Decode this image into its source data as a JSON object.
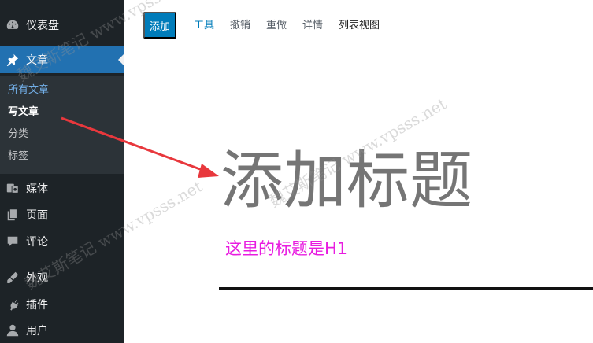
{
  "sidebar": {
    "items": [
      {
        "label": "仪表盘",
        "icon": "dashboard-icon"
      },
      {
        "label": "文章",
        "icon": "pin-icon"
      },
      {
        "label": "媒体",
        "icon": "media-icon"
      },
      {
        "label": "页面",
        "icon": "page-icon"
      },
      {
        "label": "评论",
        "icon": "comment-icon"
      },
      {
        "label": "外观",
        "icon": "appearance-icon"
      },
      {
        "label": "插件",
        "icon": "plugin-icon"
      },
      {
        "label": "用户",
        "icon": "user-icon"
      }
    ],
    "submenu": [
      {
        "label": "所有文章"
      },
      {
        "label": "写文章"
      },
      {
        "label": "分类"
      },
      {
        "label": "标签"
      }
    ]
  },
  "toolbar": {
    "add_label": "添加",
    "tools_label": "工具",
    "undo_label": "撤销",
    "redo_label": "重做",
    "details_label": "详情",
    "list_view_label": "列表视图"
  },
  "editor": {
    "title_placeholder": "添加标题",
    "annotation": "这里的标题是H1"
  },
  "watermark": {
    "text": "魏艾斯笔记 www.vpsss.net"
  },
  "colors": {
    "sidebar_bg": "#1d2327",
    "active_bg": "#2271b1",
    "primary_button": "#007cba",
    "annotation": "#e81ce0",
    "arrow": "#e8383d"
  }
}
